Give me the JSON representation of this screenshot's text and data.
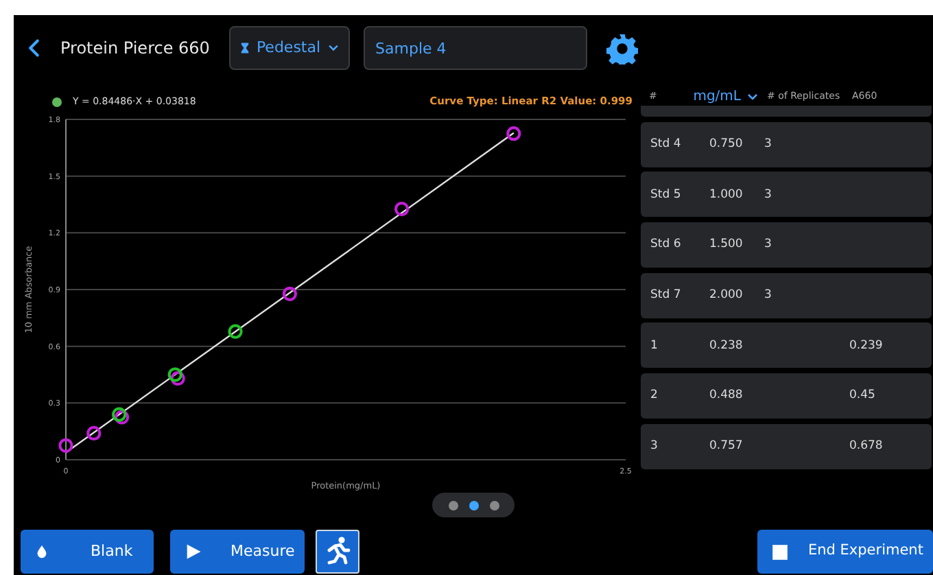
{
  "header": {
    "title": "Protein Pierce 660",
    "mode_dropdown": "Pedestal",
    "sample_name": "Sample 4"
  },
  "chart": {
    "equation": "Y = 0.84486·X + 0.03818",
    "curve_info": "Curve Type: Linear  R2 Value: 0.999",
    "chart_data": {
      "type": "scatter",
      "grid": true,
      "xlabel": "Protein(mg/mL)",
      "ylabel": "10 mm Absorbance",
      "xlim": [
        0,
        2.5
      ],
      "ylim": [
        0,
        1.8
      ],
      "xticks": [
        0,
        2.5
      ],
      "yticks": [
        0,
        0.3,
        0.6,
        0.9,
        1.2,
        1.5,
        1.8
      ],
      "series": [
        {
          "type": "line",
          "color": "#e0e0e0",
          "x": [
            0,
            2
          ],
          "values": [
            0.038,
            1.728
          ]
        },
        {
          "color": "#c21fd6",
          "x": [
            0,
            0.125,
            0.25,
            0.5,
            1,
            1.5,
            2
          ],
          "values": [
            0.075,
            0.14,
            0.225,
            0.43,
            0.877,
            1.326,
            1.725
          ]
        },
        {
          "color": "#22c22a",
          "x": [
            0.238,
            0.488,
            0.757
          ],
          "values": [
            0.239,
            0.45,
            0.678
          ]
        }
      ]
    }
  },
  "table": {
    "columns": [
      {
        "label": "#",
        "kind": "plain"
      },
      {
        "label": "mg/mL",
        "kind": "dropdown"
      },
      {
        "label": "# of Replicates",
        "kind": "plain"
      },
      {
        "label": "A660",
        "kind": "plain"
      }
    ],
    "rows": [
      {
        "id": "Std 4",
        "conc": "0.750",
        "replicates": "3"
      },
      {
        "id": "Std 5",
        "conc": "1.000",
        "replicates": "3"
      },
      {
        "id": "Std 6",
        "conc": "1.500",
        "replicates": "3"
      },
      {
        "id": "Std 7",
        "conc": "2.000",
        "replicates": "3"
      },
      {
        "id": "1",
        "conc": "0.238",
        "a660": "0.239"
      },
      {
        "id": "2",
        "conc": "0.488",
        "a660": "0.45"
      },
      {
        "id": "3",
        "conc": "0.757",
        "a660": "0.678"
      }
    ]
  },
  "pager": [
    {
      "selected": false
    },
    {
      "selected": true
    },
    {
      "selected": false
    }
  ],
  "buttons": [
    {
      "label": "Blank",
      "kind": "blank"
    },
    {
      "label": "Measure",
      "kind": "measure"
    },
    {
      "kind": "run"
    },
    {
      "label": "End Experiment",
      "kind": "end"
    }
  ]
}
